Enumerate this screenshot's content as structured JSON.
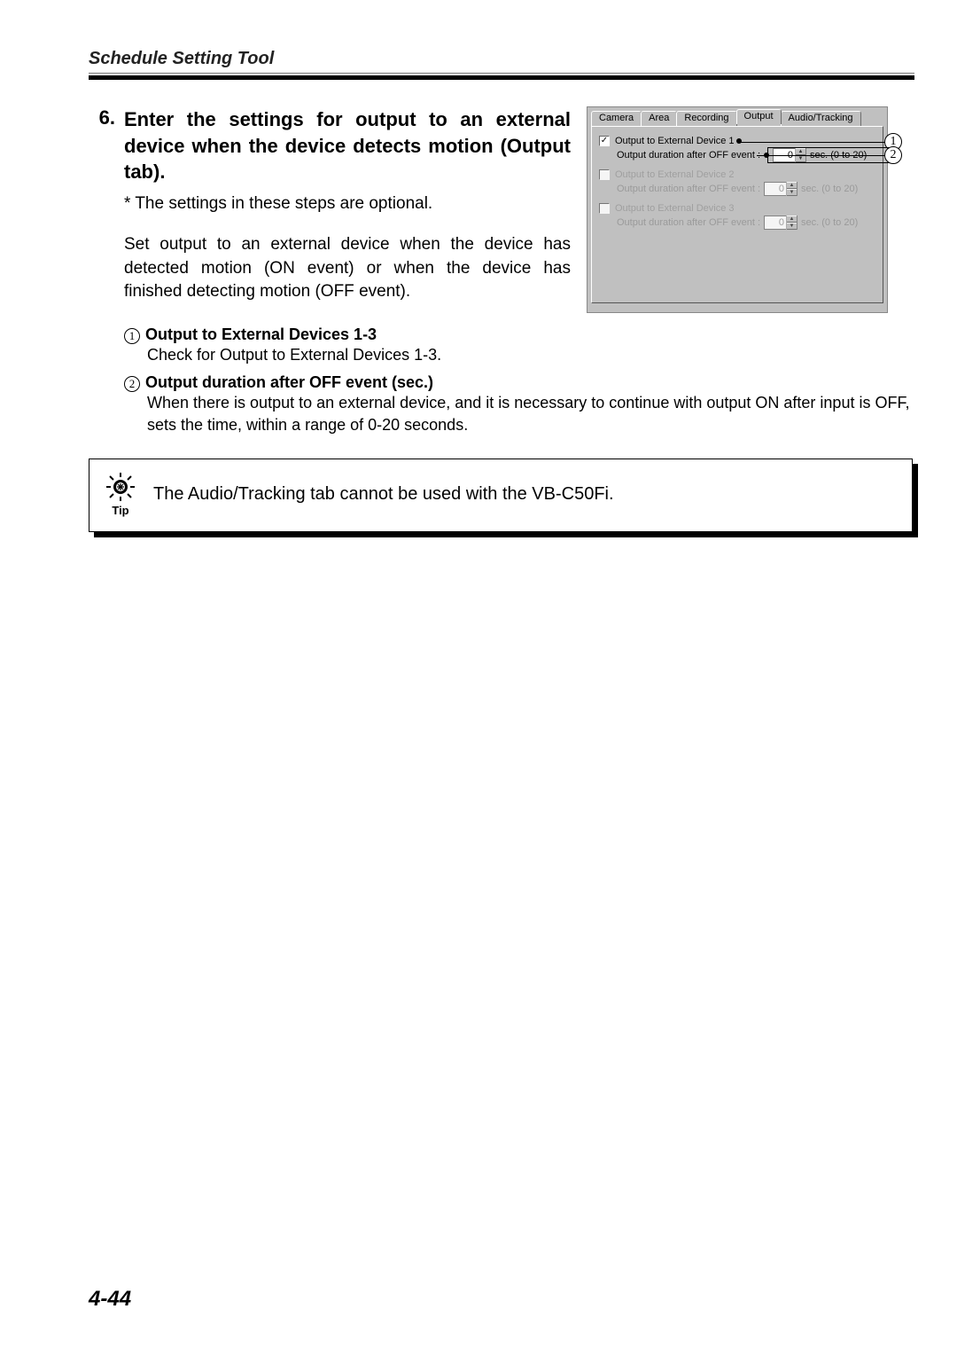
{
  "header": {
    "title": "Schedule Setting Tool"
  },
  "step": {
    "number": "6.",
    "title": "Enter the settings for output to an external device when the device detects motion (Output tab).",
    "note": "* The settings in these steps are optional.",
    "paragraph": "Set output to an external device when the device has detected motion (ON event) or when the device has finished detecting motion (OFF event)."
  },
  "details": [
    {
      "marker": "1",
      "label": "Output to External Devices 1-3",
      "desc": "Check for Output to External Devices 1-3."
    },
    {
      "marker": "2",
      "label": "Output duration after OFF event (sec.)",
      "desc": "When there is output to an external device, and it is necessary to continue with output ON after input is OFF, sets the time, within a range of 0-20 seconds."
    }
  ],
  "panel": {
    "tabs": [
      "Camera",
      "Area",
      "Recording",
      "Output",
      "Audio/Tracking"
    ],
    "selected_tab": "Output",
    "devices": [
      {
        "checked": true,
        "label": "Output to External Device 1",
        "sub_label": "Output duration after OFF event :",
        "value": "0",
        "range": "sec. (0 to 20)"
      },
      {
        "checked": false,
        "label": "Output to External Device 2",
        "sub_label": "Output duration after OFF event :",
        "value": "0",
        "range": "sec. (0 to 20)"
      },
      {
        "checked": false,
        "label": "Output to External Device 3",
        "sub_label": "Output duration after OFF event :",
        "value": "0",
        "range": "sec. (0 to 20)"
      }
    ],
    "callouts": [
      "1",
      "2"
    ]
  },
  "tip": {
    "label": "Tip",
    "text": "The Audio/Tracking tab cannot be used with the VB-C50Fi."
  },
  "page_number": "4-44"
}
